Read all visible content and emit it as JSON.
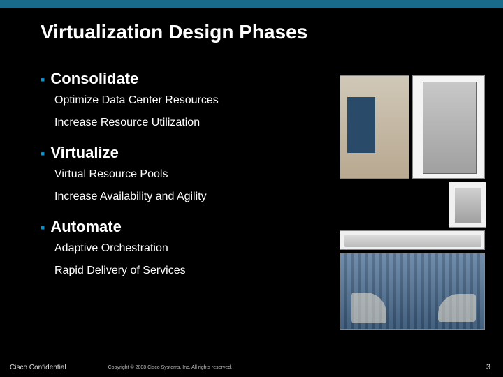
{
  "title": "Virtualization Design Phases",
  "phases": [
    {
      "title": "Consolidate",
      "subs": [
        "Optimize Data Center Resources",
        "Increase Resource Utilization"
      ]
    },
    {
      "title": "Virtualize",
      "subs": [
        "Virtual Resource Pools",
        "Increase Availability and Agility"
      ]
    },
    {
      "title": "Automate",
      "subs": [
        "Adaptive Orchestration",
        "Rapid Delivery of Services"
      ]
    }
  ],
  "footer": {
    "left": "Cisco Confidential",
    "mid": "Copyright © 2008 Cisco Systems, Inc. All rights reserved.",
    "page": "3"
  }
}
